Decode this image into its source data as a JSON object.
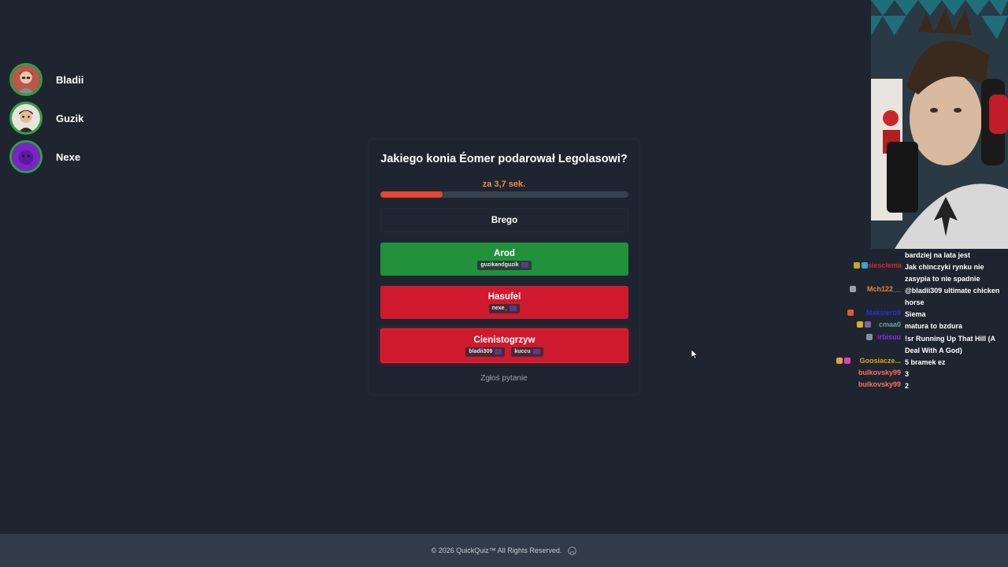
{
  "players": [
    {
      "name": "Bladii",
      "avatar_icon": "player-avatar-bladii"
    },
    {
      "name": "Guzik",
      "avatar_icon": "player-avatar-guzik"
    },
    {
      "name": "Nexe",
      "avatar_icon": "player-avatar-nexe"
    }
  ],
  "quiz": {
    "question": "Jakiego konia Éomer podarował Legolasowi?",
    "timer_text": "za 3,7 sek.",
    "timer_progress": 0.25,
    "answers": [
      {
        "label": "Brego",
        "state": "neutral",
        "voters": []
      },
      {
        "label": "Arod",
        "state": "correct",
        "voters": [
          "guzikandguzik"
        ]
      },
      {
        "label": "Hasufel",
        "state": "wrong",
        "voters": [
          "nexe_"
        ]
      },
      {
        "label": "Cienistogrzyw",
        "state": "wrong",
        "voters": [
          "bladii309",
          "kuccu"
        ]
      }
    ],
    "report_label": "Zgłoś pytanie"
  },
  "chat": [
    {
      "user": "",
      "user_color": "#ffffff",
      "text": "bardziej na lata jest"
    },
    {
      "user": "siesclema",
      "user_color": "#d0292f",
      "text": "Jak chinczyki rynku nie zasypia to nie spadnie"
    },
    {
      "user": "Mch122__",
      "user_color": "#e0873a",
      "text": "@bladii309 ultimate chicken horse"
    },
    {
      "user": "Maksiero9",
      "user_color": "#2b2fd6",
      "text": "Siema"
    },
    {
      "user": "cmaa0",
      "user_color": "#5fa7a2",
      "text": "matura to bzdura"
    },
    {
      "user": "irbisuu",
      "user_color": "#8a2be2",
      "text": "!sr Running Up That Hill (A Deal With A God)"
    },
    {
      "user": "Goosiacze...",
      "user_color": "#daa520",
      "text": "5 bramek ez"
    },
    {
      "user": "bulkovsky99",
      "user_color": "#ff6f61",
      "text": "3"
    },
    {
      "user": "bulkovsky99",
      "user_color": "#ff6f61",
      "text": "2"
    }
  ],
  "footer": {
    "text": "© 2026  QuickQuiz™ All Rights Reserved.",
    "icon": "github-icon"
  },
  "colors": {
    "background": "#1e2530",
    "correct": "#21923b",
    "wrong": "#cf1a2d",
    "timer": "#e8462f",
    "footer": "#323b49"
  }
}
